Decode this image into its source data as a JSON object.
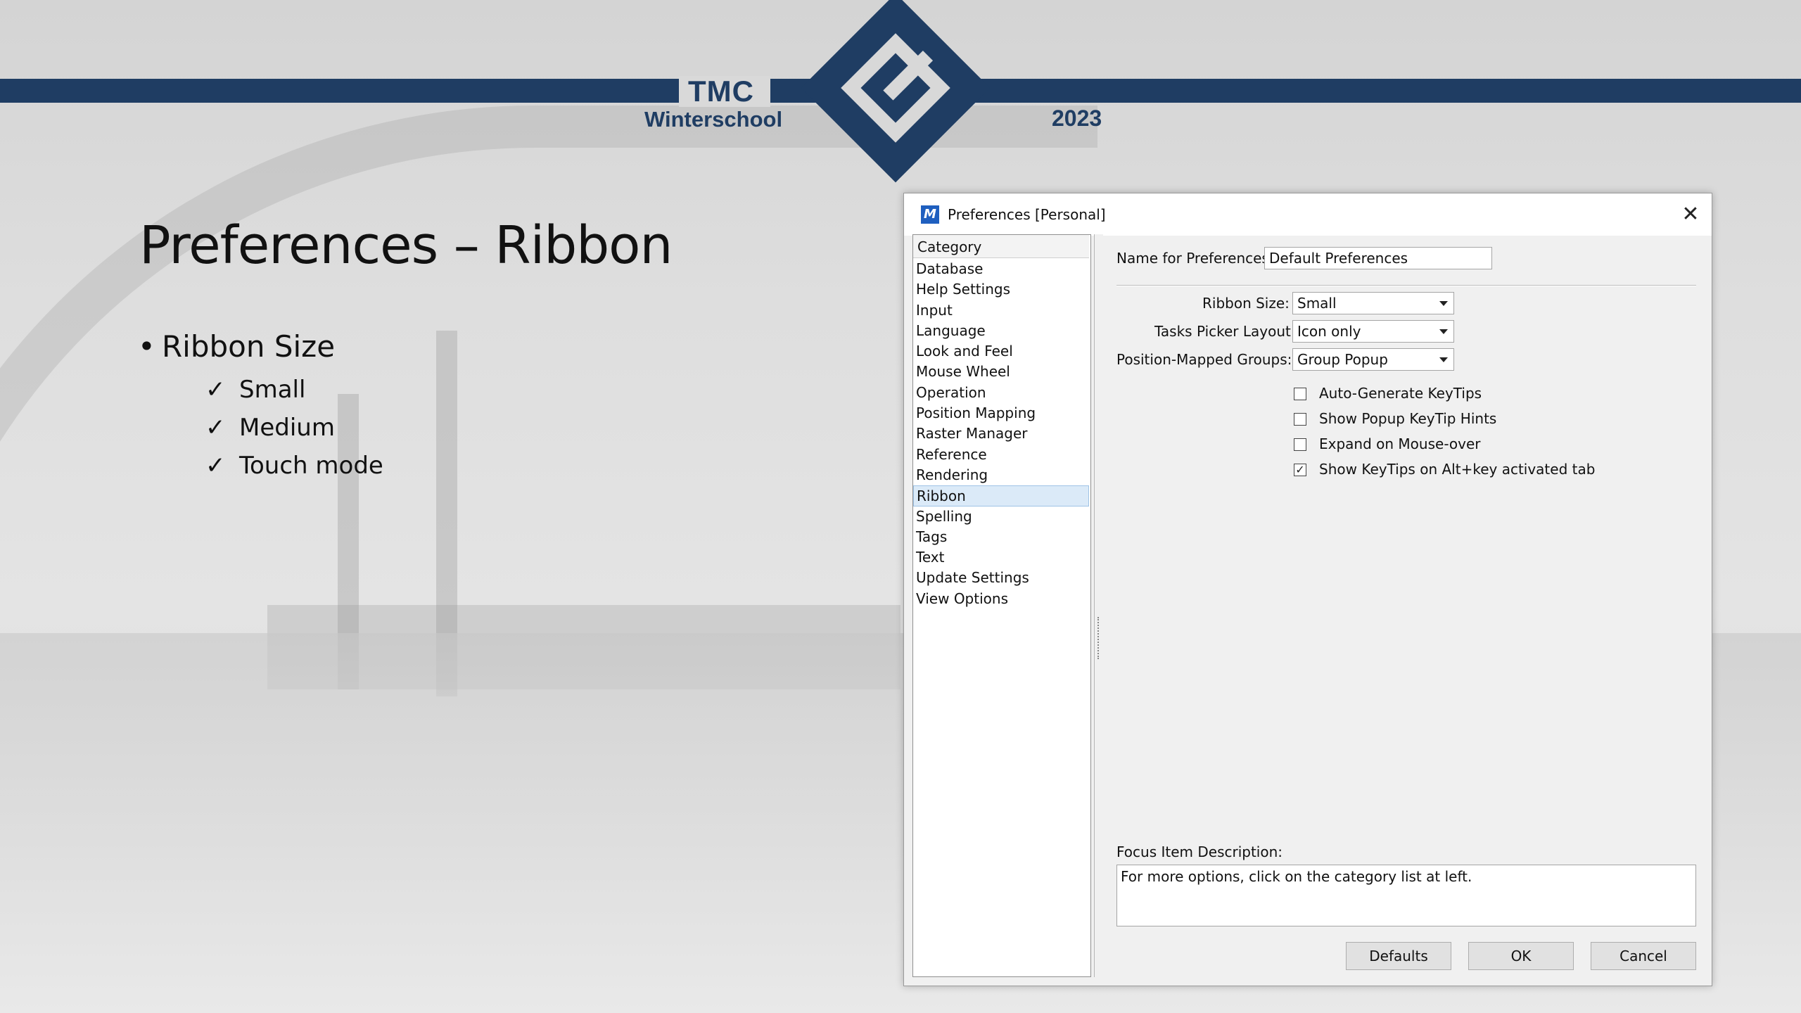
{
  "header": {
    "logo_top": "TMC",
    "logo_bottom": "Winterschool",
    "year": "2023",
    "brand_color": "#1f3d63"
  },
  "slide": {
    "title": "Preferences – Ribbon",
    "bullet": "Ribbon Size",
    "sub_items": [
      "Small",
      "Medium",
      "Touch mode"
    ],
    "bullet_glyph": "•",
    "check_glyph": "✓"
  },
  "dialog": {
    "title": "Preferences [Personal]",
    "app_icon": "microstation-icon",
    "close_glyph": "✕",
    "category_header": "Category",
    "categories": [
      "Database",
      "Help Settings",
      "Input",
      "Language",
      "Look and Feel",
      "Mouse Wheel",
      "Operation",
      "Position Mapping",
      "Raster Manager",
      "Reference",
      "Rendering",
      "Ribbon",
      "Spelling",
      "Tags",
      "Text",
      "Update Settings",
      "View Options"
    ],
    "selected_category": "Ribbon",
    "name_label": "Name for Preferences:",
    "name_value": "Default Preferences",
    "ribbon_size_label": "Ribbon Size:",
    "ribbon_size_value": "Small",
    "tasks_picker_label": "Tasks Picker Layout:",
    "tasks_picker_value": "Icon only",
    "position_mapped_label": "Position-Mapped Groups:",
    "position_mapped_value": "Group Popup",
    "checkboxes": [
      {
        "label": "Auto-Generate KeyTips",
        "checked": false
      },
      {
        "label": "Show Popup KeyTip Hints",
        "checked": false
      },
      {
        "label": "Expand on Mouse-over",
        "checked": false
      },
      {
        "label": "Show KeyTips on Alt+key activated tab",
        "checked": true
      }
    ],
    "check_mark": "✓",
    "focus_label": "Focus Item Description:",
    "focus_text": "For more options, click on the category list at left.",
    "buttons": {
      "defaults": "Defaults",
      "ok": "OK",
      "cancel": "Cancel"
    }
  }
}
